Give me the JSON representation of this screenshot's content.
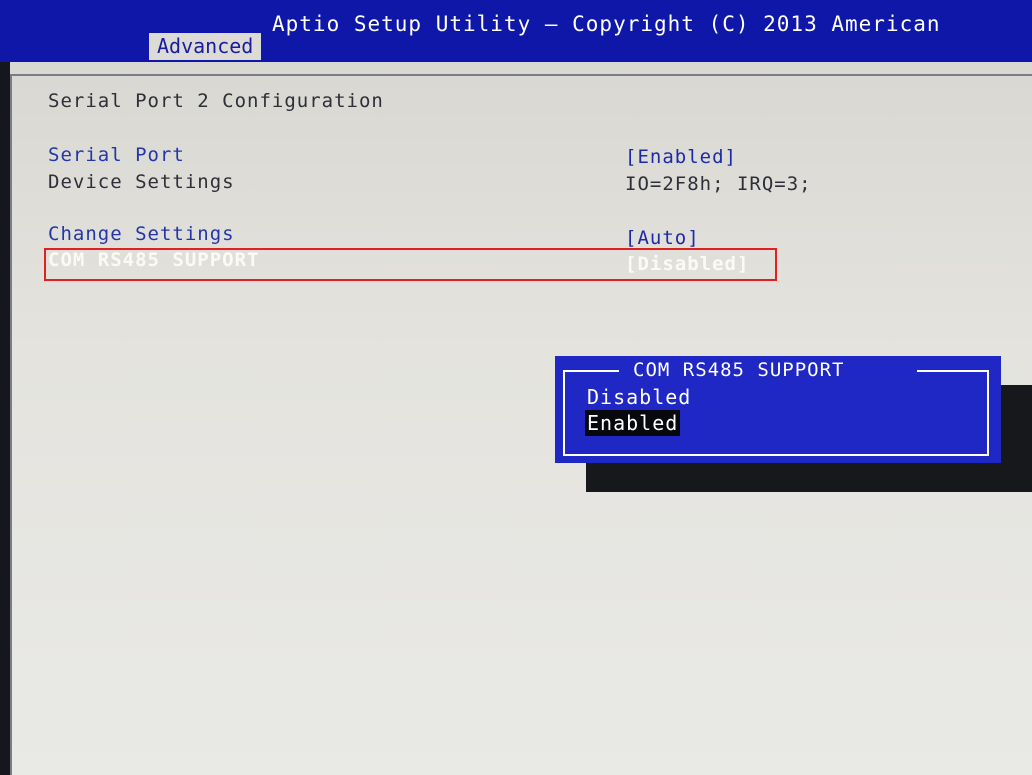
{
  "header": {
    "title": "Aptio Setup Utility – Copyright (C) 2013 American",
    "active_tab": "Advanced"
  },
  "page": {
    "heading": "Serial Port 2 Configuration"
  },
  "settings": [
    {
      "label": "Serial Port",
      "value": "[Enabled]"
    },
    {
      "label": "Device Settings",
      "value": "IO=2F8h; IRQ=3;"
    },
    {
      "label": "Change Settings",
      "value": "[Auto]"
    },
    {
      "label": "COM RS485 SUPPORT",
      "value": "[Disabled]"
    }
  ],
  "popup": {
    "title": "COM RS485 SUPPORT",
    "options": [
      "Disabled",
      "Enabled"
    ],
    "selected": "Enabled"
  },
  "colors": {
    "header_bg": "#0f17a8",
    "popup_bg": "#1f27c4",
    "highlight_border": "#e2201e",
    "screen_bg": "#e4e3de"
  }
}
